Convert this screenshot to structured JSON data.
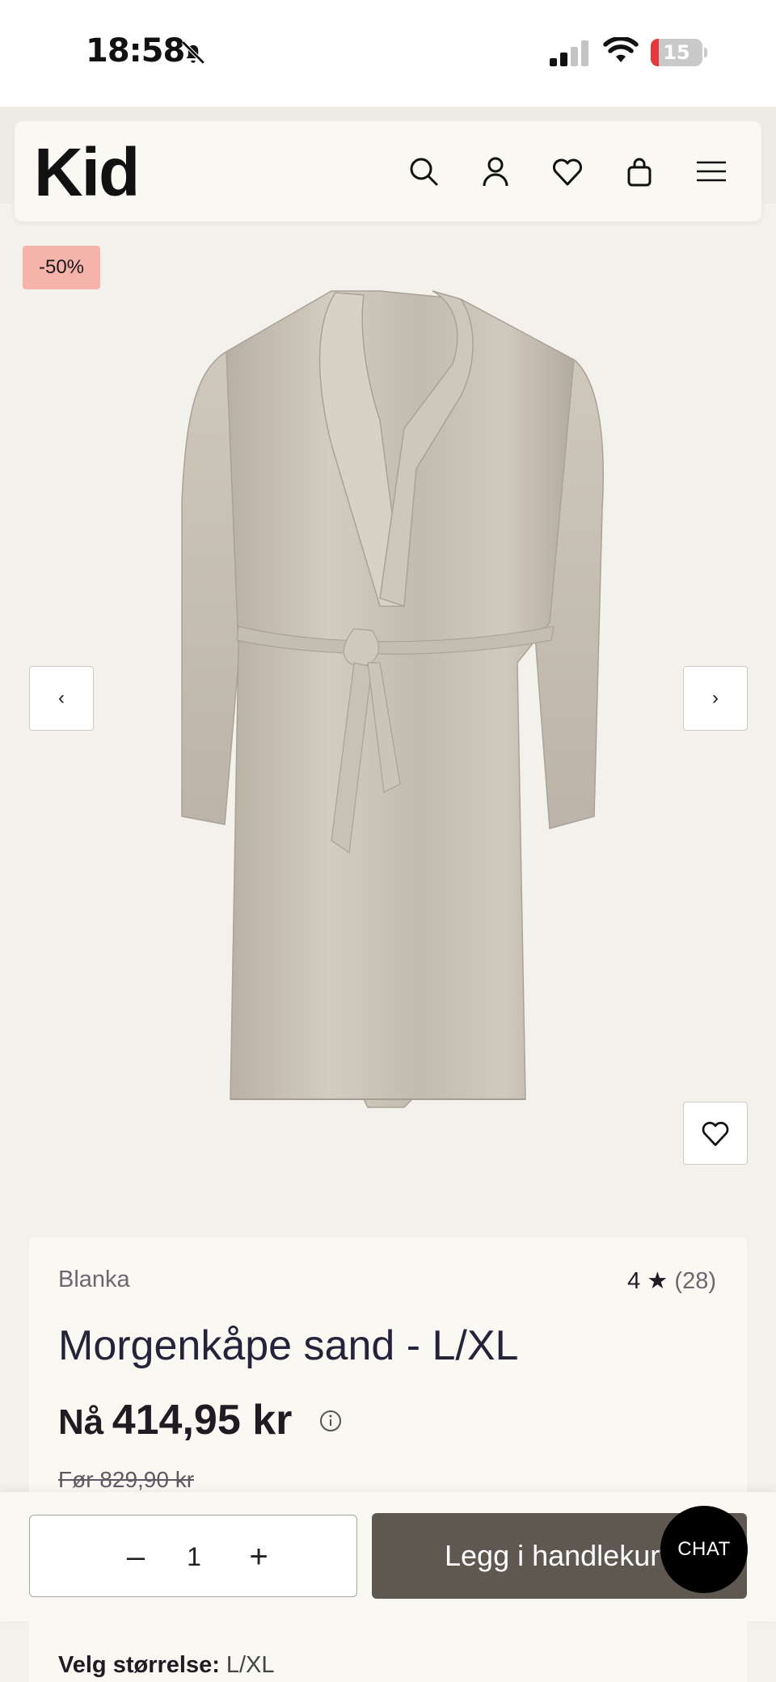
{
  "status_bar": {
    "time": "18:58",
    "battery_level": "15",
    "battery_fraction": 0.15,
    "icons": [
      "bell-off-icon",
      "cell-signal-icon",
      "wifi-icon",
      "battery-charging-icon"
    ]
  },
  "header": {
    "logo": "Kid",
    "icons": [
      "search-icon",
      "account-icon",
      "wishlist-icon",
      "cart-icon",
      "menu-icon"
    ]
  },
  "gallery": {
    "discount_badge": "-50%",
    "prev_label": "‹",
    "next_label": "›",
    "image_description_icon": "robe-product-image"
  },
  "product": {
    "brand": "Blanka",
    "rating_value": "4 ★",
    "rating_count": "(28)",
    "title": "Morgenkåpe sand - L/XL",
    "price_prefix": "Nå",
    "price": "414,95 kr",
    "old_price": "Før 829,90 kr"
  },
  "purchase": {
    "minus": "–",
    "quantity": "1",
    "plus": "+",
    "add_to_cart": "Legg i handlekurv"
  },
  "chat": {
    "label": "CHAT"
  },
  "size": {
    "label": "Velg størrelse:",
    "value": "L/XL"
  },
  "colors": {
    "page_bg": "#f3f1ec",
    "card_bg": "#faf8f3",
    "badge_bg": "#f6b3ab",
    "cta_bg": "#5f5851",
    "battery_red": "#e5383b"
  }
}
